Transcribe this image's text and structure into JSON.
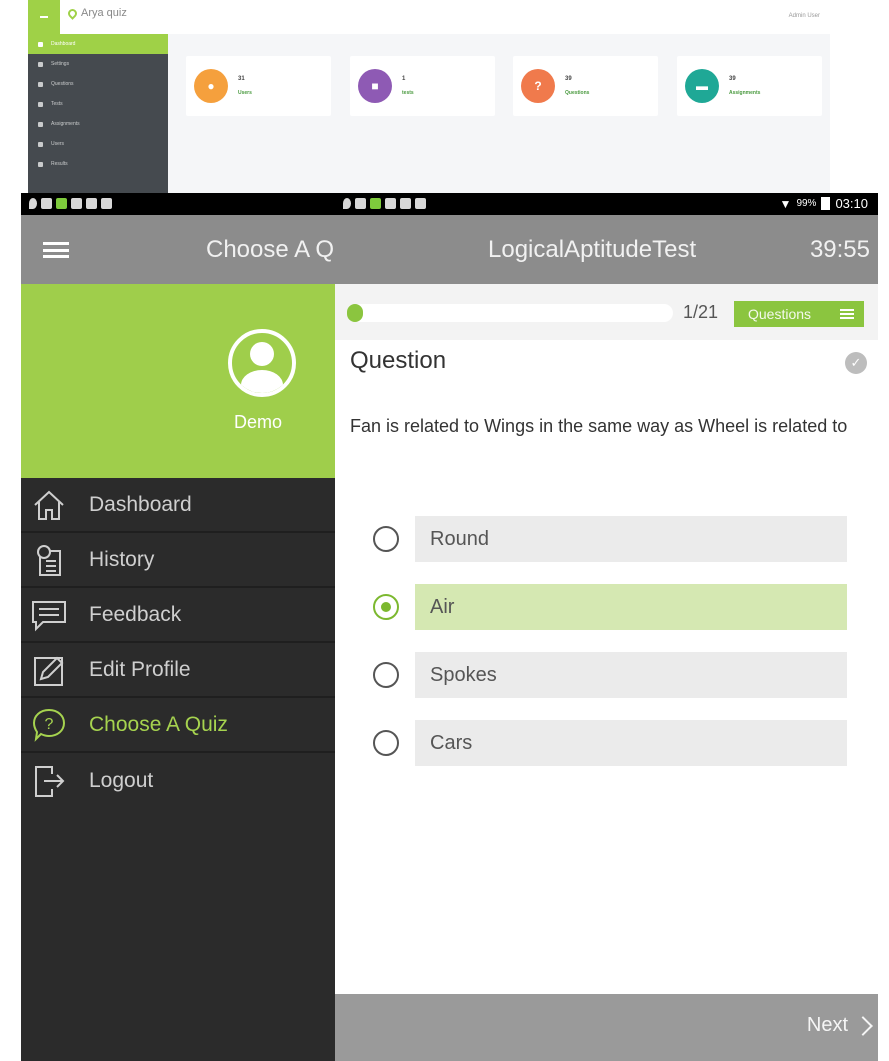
{
  "web_admin": {
    "logo_text": "Arya quiz",
    "user_label": "Admin User",
    "sidebar": [
      "Dashboard",
      "Settings",
      "Questions",
      "Tests",
      "Assignments",
      "Users",
      "Results"
    ],
    "cards": [
      {
        "count": "31",
        "label": "Users",
        "icon": "user-icon",
        "color": "#f5a03d"
      },
      {
        "count": "1",
        "label": "tests",
        "icon": "tests-icon",
        "color": "#8e5ab4"
      },
      {
        "count": "39",
        "label": "Questions",
        "icon": "question-icon",
        "color": "#f07a4c"
      },
      {
        "count": "39",
        "label": "Assignments",
        "icon": "assignment-icon",
        "color": "#1fa896"
      }
    ]
  },
  "status_bar": {
    "battery": "99%",
    "time": "03:10"
  },
  "drawer": {
    "title": "Choose A Q",
    "profile_name": "Demo",
    "items": [
      {
        "label": "Dashboard",
        "icon": "home-icon"
      },
      {
        "label": "History",
        "icon": "history-icon"
      },
      {
        "label": "Feedback",
        "icon": "feedback-icon"
      },
      {
        "label": "Edit Profile",
        "icon": "edit-icon"
      },
      {
        "label": "Choose A Quiz",
        "icon": "question-icon",
        "active": true
      },
      {
        "label": "Logout",
        "icon": "logout-icon"
      }
    ]
  },
  "quiz": {
    "title": "LogicalAptitudeTest",
    "timer": "39:55",
    "progress": {
      "current": 1,
      "total": 21,
      "label": "1/21",
      "fraction": 0.0476
    },
    "questions_button": "Questions",
    "heading": "Question",
    "text": "Fan is related to Wings in the same way as Wheel is related to",
    "options": [
      {
        "label": "Round",
        "selected": false
      },
      {
        "label": "Air",
        "selected": true
      },
      {
        "label": "Spokes",
        "selected": false
      },
      {
        "label": "Cars",
        "selected": false
      }
    ],
    "next_label": "Next"
  },
  "colors": {
    "accent": "#8bc53f",
    "drawer_dark": "#2b2b2b",
    "toolbar": "#8c8c8c"
  }
}
